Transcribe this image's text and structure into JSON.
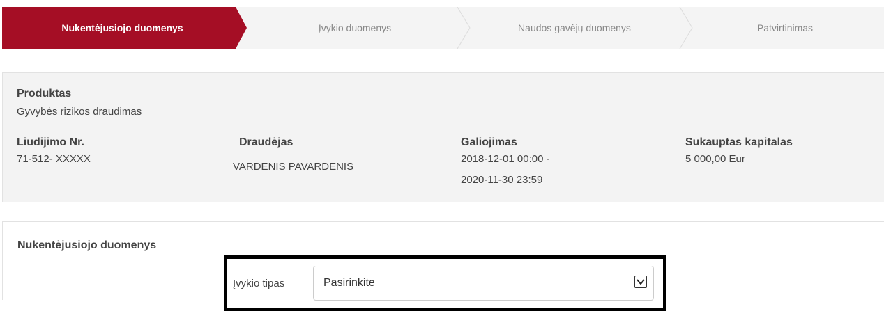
{
  "stepper": {
    "steps": [
      {
        "label": "Nukentėjusiojo duomenys",
        "active": true
      },
      {
        "label": "Įvykio duomenys",
        "active": false
      },
      {
        "label": "Naudos gavėjų duomenys",
        "active": false
      },
      {
        "label": "Patvirtinimas",
        "active": false
      }
    ],
    "active_color": "#a50e25"
  },
  "policy": {
    "product_label": "Produktas",
    "product_value": "Gyvybės rizikos draudimas",
    "certificate_label": "Liudijimo Nr.",
    "certificate_value": "71-512- XXXXX",
    "insurer_label": "Draudėjas",
    "insurer_value": "VARDENIS PAVARDENIS",
    "validity_label": "Galiojimas",
    "validity_from": "2018-12-01 00:00 -",
    "validity_to": "2020-11-30 23:59",
    "capital_label": "Sukauptas kapitalas",
    "capital_value": "5 000,00 Eur"
  },
  "form": {
    "title": "Nukentėjusiojo duomenys",
    "event_type_label": "Įvykio tipas",
    "event_type_value": "Pasirinkite"
  }
}
